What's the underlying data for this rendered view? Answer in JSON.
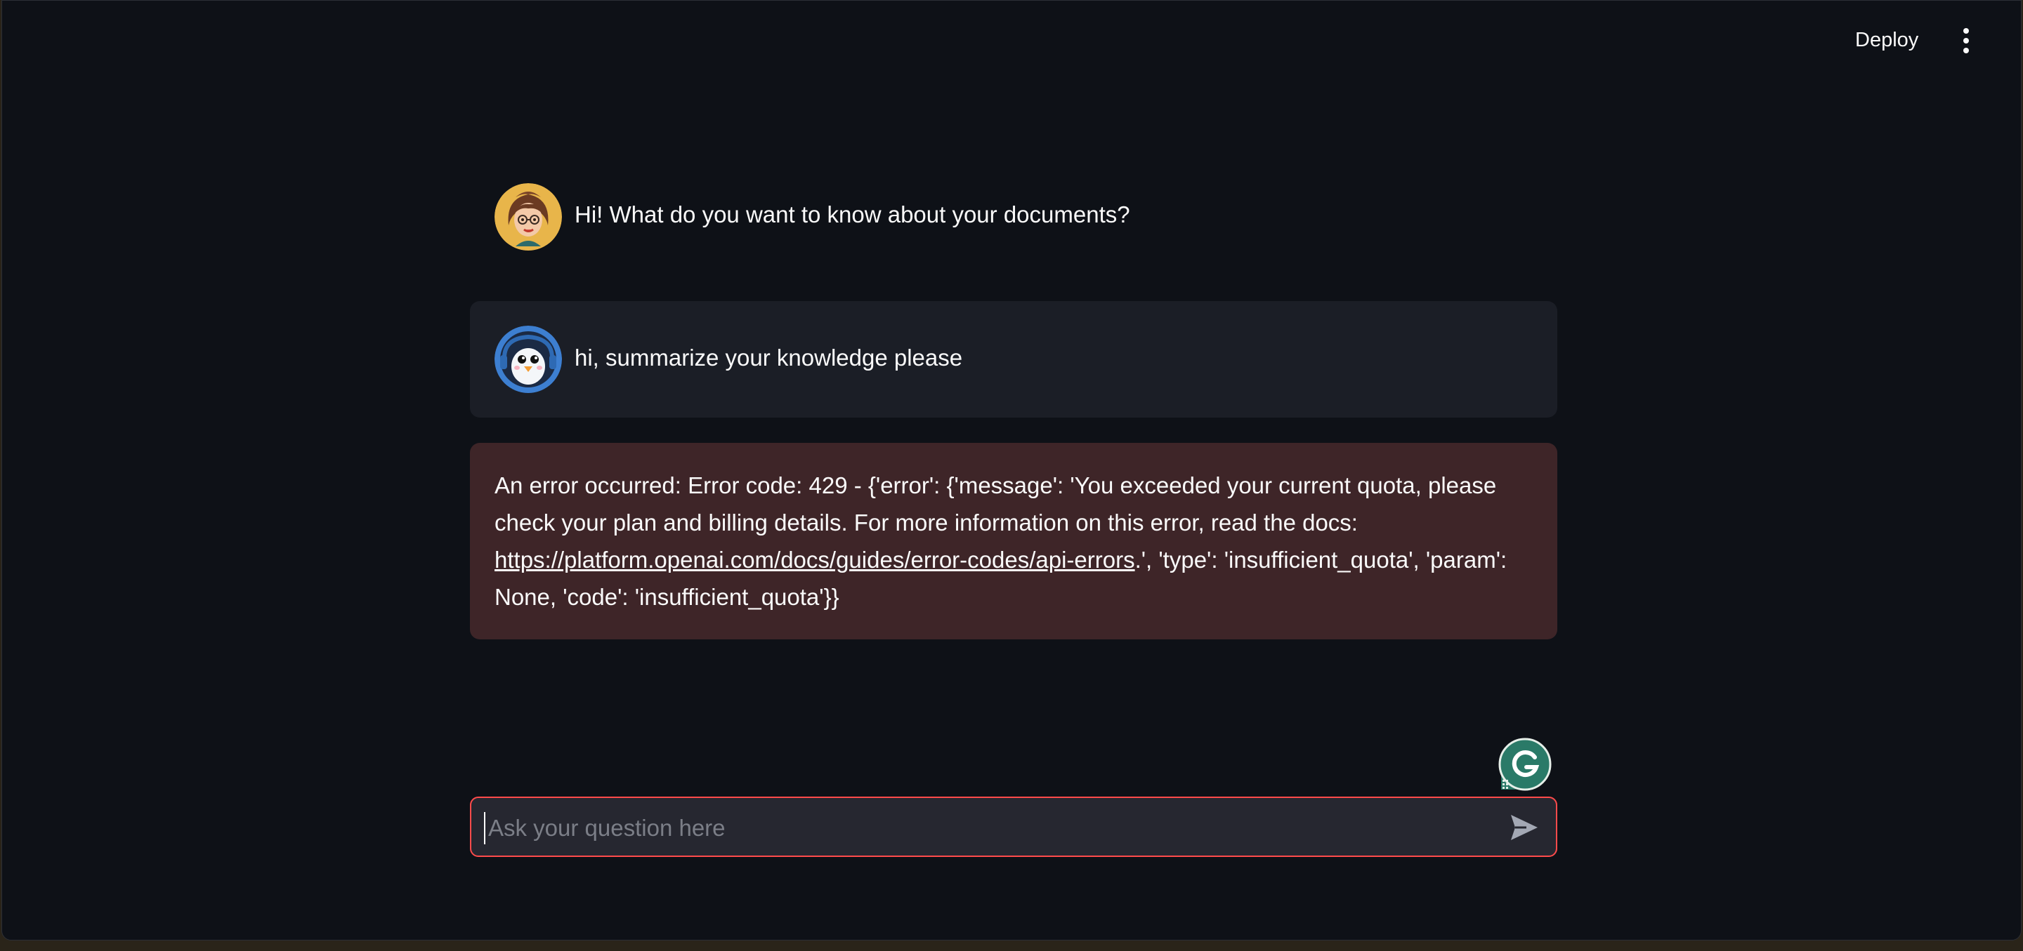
{
  "header": {
    "deploy_label": "Deploy",
    "menu_icon": "vertical-dots-icon"
  },
  "messages": [
    {
      "role": "assistant",
      "avatar": "woman-with-glasses-avatar",
      "text": "Hi! What do you want to know about your documents?"
    },
    {
      "role": "user",
      "avatar": "penguin-avatar",
      "text": "hi, summarize your knowledge please"
    }
  ],
  "error": {
    "prefix": "An error occurred: Error code: 429 - {'error': {'message': 'You exceeded your current quota, please check your plan and billing details. For more information on this error, read the docs: ",
    "link_text": "https://platform.openai.com/docs/guides/error-codes/api-errors",
    "suffix": ".', 'type': 'insufficient_quota', 'param': None, 'code': 'insufficient_quota'}}"
  },
  "chat_input": {
    "placeholder": "Ask your question here",
    "value": "",
    "send_icon": "send-arrow-icon"
  },
  "overlay": {
    "grammarly_icon": "grammarly-icon"
  },
  "colors": {
    "background": "#0e1117",
    "user_bubble": "#1b1e26",
    "error_bubble": "#3e2528",
    "input_border": "#ff4b4b",
    "input_background": "#262730",
    "text": "#fafafa"
  }
}
